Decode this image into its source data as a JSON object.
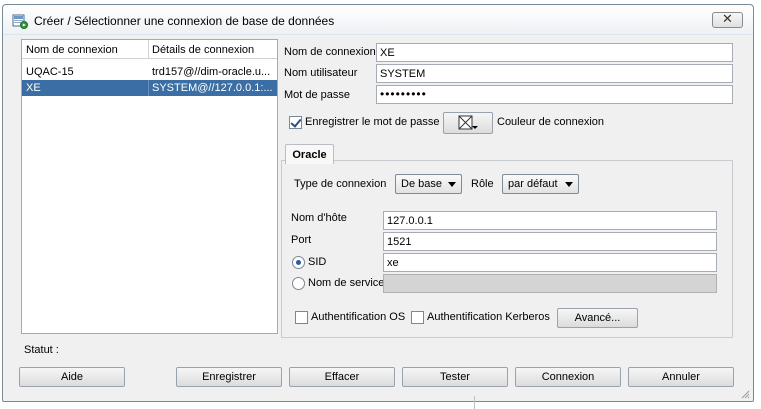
{
  "window": {
    "title": "Créer / Sélectionner une connexion de base de données",
    "close_label": "✕"
  },
  "connection_list": {
    "columns": [
      "Nom de connexion",
      "Détails de connexion"
    ],
    "rows": [
      {
        "name": "UQAC-15",
        "details": "trd157@//dim-oracle.u...",
        "selected": false
      },
      {
        "name": "XE",
        "details": "SYSTEM@//127.0.0.1:...",
        "selected": true
      }
    ]
  },
  "form": {
    "connection_name_label": "Nom de connexion",
    "connection_name_value": "XE",
    "username_label": "Nom utilisateur",
    "username_value": "SYSTEM",
    "password_label": "Mot de passe",
    "password_value": "•••••••••",
    "save_password_label": "Enregistrer le mot de passe",
    "save_password_checked": true,
    "connection_color_label": "Couleur de connexion"
  },
  "oracle_tab": {
    "tab_label": "Oracle",
    "connection_type_label": "Type de connexion",
    "connection_type_value": "De base",
    "role_label": "Rôle",
    "role_value": "par défaut",
    "hostname_label": "Nom d'hôte",
    "hostname_value": "127.0.0.1",
    "port_label": "Port",
    "port_value": "1521",
    "sid_label": "SID",
    "sid_value": "xe",
    "sid_selected": true,
    "service_name_label": "Nom de service",
    "service_name_value": "",
    "os_auth_label": "Authentification OS",
    "kerberos_auth_label": "Authentification Kerberos",
    "advanced_label": "Avancé..."
  },
  "status_label": "Statut :",
  "buttons": {
    "help": "Aide",
    "save": "Enregistrer",
    "clear": "Effacer",
    "test": "Tester",
    "connect": "Connexion",
    "cancel": "Annuler"
  },
  "colors": {
    "selection": "#3a6ea5",
    "dialog_background": "#f0f0f0"
  }
}
